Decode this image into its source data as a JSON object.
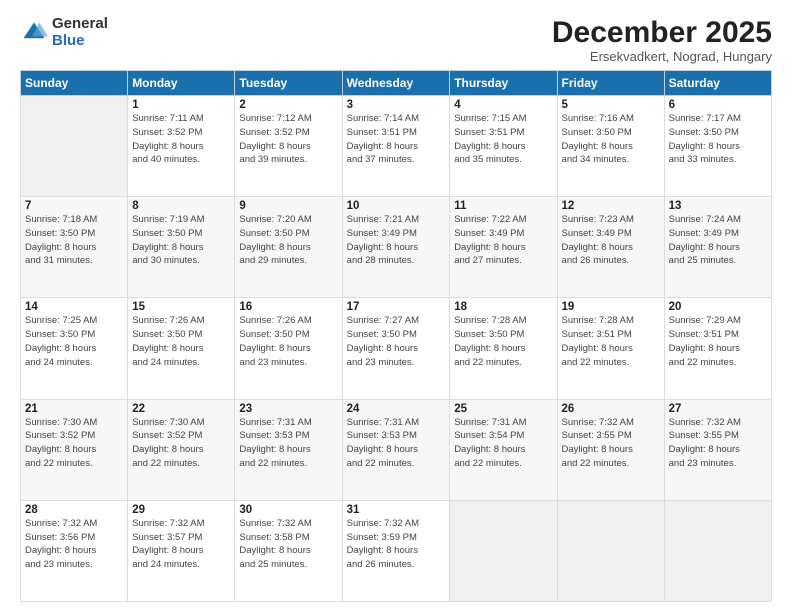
{
  "logo": {
    "general": "General",
    "blue": "Blue"
  },
  "header": {
    "month": "December 2025",
    "location": "Ersekvadkert, Nograd, Hungary"
  },
  "weekdays": [
    "Sunday",
    "Monday",
    "Tuesday",
    "Wednesday",
    "Thursday",
    "Friday",
    "Saturday"
  ],
  "weeks": [
    [
      {
        "day": "",
        "info": ""
      },
      {
        "day": "1",
        "info": "Sunrise: 7:11 AM\nSunset: 3:52 PM\nDaylight: 8 hours\nand 40 minutes."
      },
      {
        "day": "2",
        "info": "Sunrise: 7:12 AM\nSunset: 3:52 PM\nDaylight: 8 hours\nand 39 minutes."
      },
      {
        "day": "3",
        "info": "Sunrise: 7:14 AM\nSunset: 3:51 PM\nDaylight: 8 hours\nand 37 minutes."
      },
      {
        "day": "4",
        "info": "Sunrise: 7:15 AM\nSunset: 3:51 PM\nDaylight: 8 hours\nand 35 minutes."
      },
      {
        "day": "5",
        "info": "Sunrise: 7:16 AM\nSunset: 3:50 PM\nDaylight: 8 hours\nand 34 minutes."
      },
      {
        "day": "6",
        "info": "Sunrise: 7:17 AM\nSunset: 3:50 PM\nDaylight: 8 hours\nand 33 minutes."
      }
    ],
    [
      {
        "day": "7",
        "info": "Sunrise: 7:18 AM\nSunset: 3:50 PM\nDaylight: 8 hours\nand 31 minutes."
      },
      {
        "day": "8",
        "info": "Sunrise: 7:19 AM\nSunset: 3:50 PM\nDaylight: 8 hours\nand 30 minutes."
      },
      {
        "day": "9",
        "info": "Sunrise: 7:20 AM\nSunset: 3:50 PM\nDaylight: 8 hours\nand 29 minutes."
      },
      {
        "day": "10",
        "info": "Sunrise: 7:21 AM\nSunset: 3:49 PM\nDaylight: 8 hours\nand 28 minutes."
      },
      {
        "day": "11",
        "info": "Sunrise: 7:22 AM\nSunset: 3:49 PM\nDaylight: 8 hours\nand 27 minutes."
      },
      {
        "day": "12",
        "info": "Sunrise: 7:23 AM\nSunset: 3:49 PM\nDaylight: 8 hours\nand 26 minutes."
      },
      {
        "day": "13",
        "info": "Sunrise: 7:24 AM\nSunset: 3:49 PM\nDaylight: 8 hours\nand 25 minutes."
      }
    ],
    [
      {
        "day": "14",
        "info": "Sunrise: 7:25 AM\nSunset: 3:50 PM\nDaylight: 8 hours\nand 24 minutes."
      },
      {
        "day": "15",
        "info": "Sunrise: 7:26 AM\nSunset: 3:50 PM\nDaylight: 8 hours\nand 24 minutes."
      },
      {
        "day": "16",
        "info": "Sunrise: 7:26 AM\nSunset: 3:50 PM\nDaylight: 8 hours\nand 23 minutes."
      },
      {
        "day": "17",
        "info": "Sunrise: 7:27 AM\nSunset: 3:50 PM\nDaylight: 8 hours\nand 23 minutes."
      },
      {
        "day": "18",
        "info": "Sunrise: 7:28 AM\nSunset: 3:50 PM\nDaylight: 8 hours\nand 22 minutes."
      },
      {
        "day": "19",
        "info": "Sunrise: 7:28 AM\nSunset: 3:51 PM\nDaylight: 8 hours\nand 22 minutes."
      },
      {
        "day": "20",
        "info": "Sunrise: 7:29 AM\nSunset: 3:51 PM\nDaylight: 8 hours\nand 22 minutes."
      }
    ],
    [
      {
        "day": "21",
        "info": "Sunrise: 7:30 AM\nSunset: 3:52 PM\nDaylight: 8 hours\nand 22 minutes."
      },
      {
        "day": "22",
        "info": "Sunrise: 7:30 AM\nSunset: 3:52 PM\nDaylight: 8 hours\nand 22 minutes."
      },
      {
        "day": "23",
        "info": "Sunrise: 7:31 AM\nSunset: 3:53 PM\nDaylight: 8 hours\nand 22 minutes."
      },
      {
        "day": "24",
        "info": "Sunrise: 7:31 AM\nSunset: 3:53 PM\nDaylight: 8 hours\nand 22 minutes."
      },
      {
        "day": "25",
        "info": "Sunrise: 7:31 AM\nSunset: 3:54 PM\nDaylight: 8 hours\nand 22 minutes."
      },
      {
        "day": "26",
        "info": "Sunrise: 7:32 AM\nSunset: 3:55 PM\nDaylight: 8 hours\nand 22 minutes."
      },
      {
        "day": "27",
        "info": "Sunrise: 7:32 AM\nSunset: 3:55 PM\nDaylight: 8 hours\nand 23 minutes."
      }
    ],
    [
      {
        "day": "28",
        "info": "Sunrise: 7:32 AM\nSunset: 3:56 PM\nDaylight: 8 hours\nand 23 minutes."
      },
      {
        "day": "29",
        "info": "Sunrise: 7:32 AM\nSunset: 3:57 PM\nDaylight: 8 hours\nand 24 minutes."
      },
      {
        "day": "30",
        "info": "Sunrise: 7:32 AM\nSunset: 3:58 PM\nDaylight: 8 hours\nand 25 minutes."
      },
      {
        "day": "31",
        "info": "Sunrise: 7:32 AM\nSunset: 3:59 PM\nDaylight: 8 hours\nand 26 minutes."
      },
      {
        "day": "",
        "info": ""
      },
      {
        "day": "",
        "info": ""
      },
      {
        "day": "",
        "info": ""
      }
    ]
  ]
}
